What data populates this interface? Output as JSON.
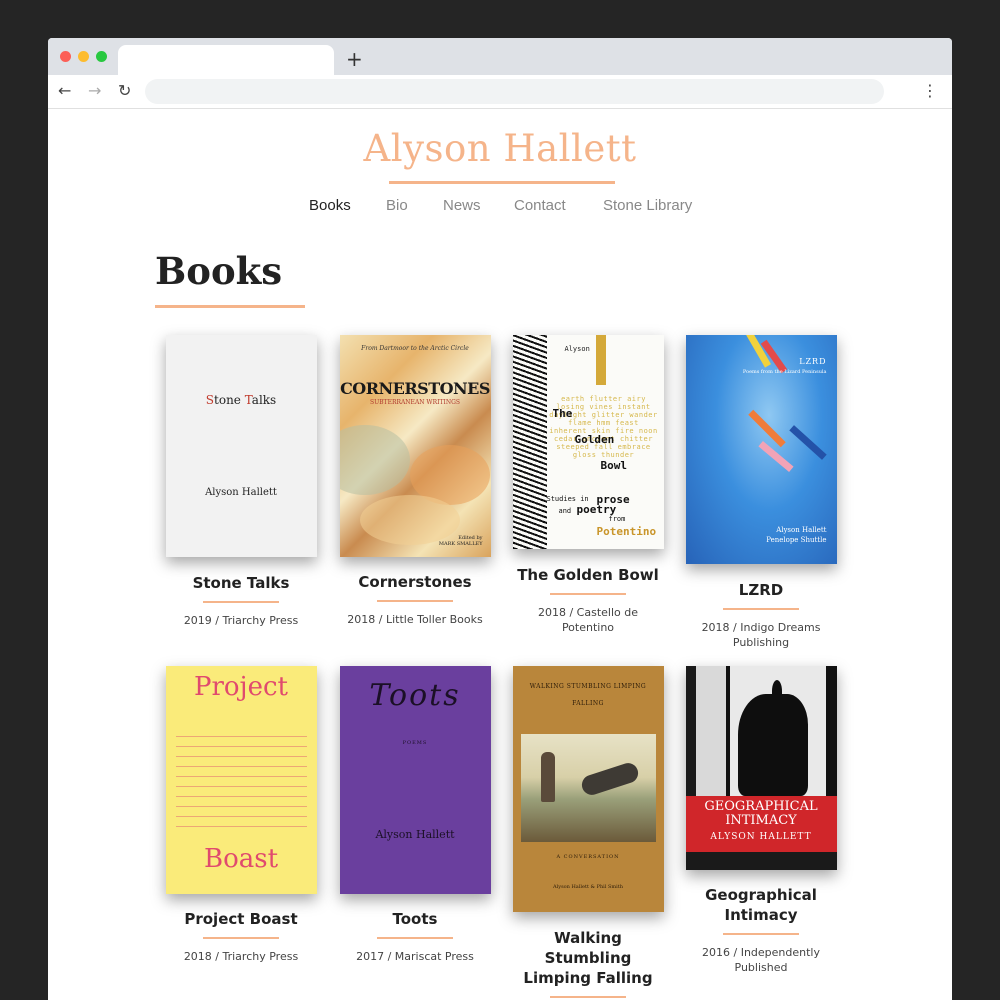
{
  "browser": {
    "new_tab_glyph": "+",
    "back_icon": "←",
    "forward_icon": "→",
    "reload_icon": "↻",
    "menu_icon": "⋮"
  },
  "site": {
    "title": "Alyson Hallett",
    "accent_color": "#f5b48a"
  },
  "nav": {
    "items": [
      {
        "label": "Books",
        "active": true
      },
      {
        "label": "Bio"
      },
      {
        "label": "News"
      },
      {
        "label": "Contact"
      },
      {
        "label": "Stone Library"
      }
    ]
  },
  "page": {
    "heading": "Books"
  },
  "books": [
    {
      "title": "Stone Talks",
      "meta": "2019 / Triarchy Press",
      "cover": {
        "title_s": "S",
        "title_rest1": "tone ",
        "title_t": "T",
        "title_rest2": "alks",
        "author": "Alyson Hallett"
      }
    },
    {
      "title": "Cornerstones",
      "meta": "2018 / Little Toller Books",
      "cover": {
        "top": "From Dartmoor to the Arctic Circle",
        "title": "CORNERSTONES",
        "subtitle": "SUBTERRANEAN WRITINGS",
        "editor_line1": "Edited by",
        "editor_line2": "MARK SMALLEY"
      }
    },
    {
      "title": "The Golden Bowl",
      "meta_line1": "2018 / Castello de",
      "meta_line2": "Potentino",
      "cover": {
        "author_first": "Alyson",
        "author_last": "HALLETT",
        "w1": "The",
        "w2": "Golden",
        "w3": "Bowl",
        "s1": "Studies in",
        "w4": "prose",
        "s2": "and",
        "w5": "poetry",
        "s3": "from",
        "w6": "Potentino",
        "ghost": "earth flutter airy losing vines instant daylight glitter wander flame hmm feast inherent skin fire noon cedar ancient chitter steeped fall embrace gloss thunder"
      }
    },
    {
      "title": "LZRD",
      "meta_line1": "2018 / Indigo Dreams",
      "meta_line2": "Publishing",
      "cover": {
        "title": "LZRD",
        "subtitle": "Poems from the Lizard Peninsula",
        "author1": "Alyson Hallett",
        "author2": "Penelope Shuttle"
      }
    },
    {
      "title": "Project Boast",
      "meta": "2018 / Triarchy Press",
      "cover": {
        "word1": "Project",
        "word2": "Boast"
      }
    },
    {
      "title": "Toots",
      "meta": "2017 / Mariscat Press",
      "cover": {
        "title": "Toots",
        "label": "POEMS",
        "author": "Alyson Hallett"
      }
    },
    {
      "title_line1": "Walking",
      "title_line2": "Stumbling",
      "title_line3": "Limping Falling",
      "cover": {
        "line1": "WALKING STUMBLING LIMPING",
        "line2": "FALLING",
        "label": "A CONVERSATION",
        "authors": "Alyson Hallett & Phil Smith"
      }
    },
    {
      "title_line1": "Geographical",
      "title_line2": "Intimacy",
      "meta_line1": "2016 / Independently",
      "meta_line2": "Published",
      "cover": {
        "line1": "GEOGRAPHICAL",
        "line2": "INTIMACY",
        "author": "ALYSON HALLETT"
      }
    }
  ]
}
